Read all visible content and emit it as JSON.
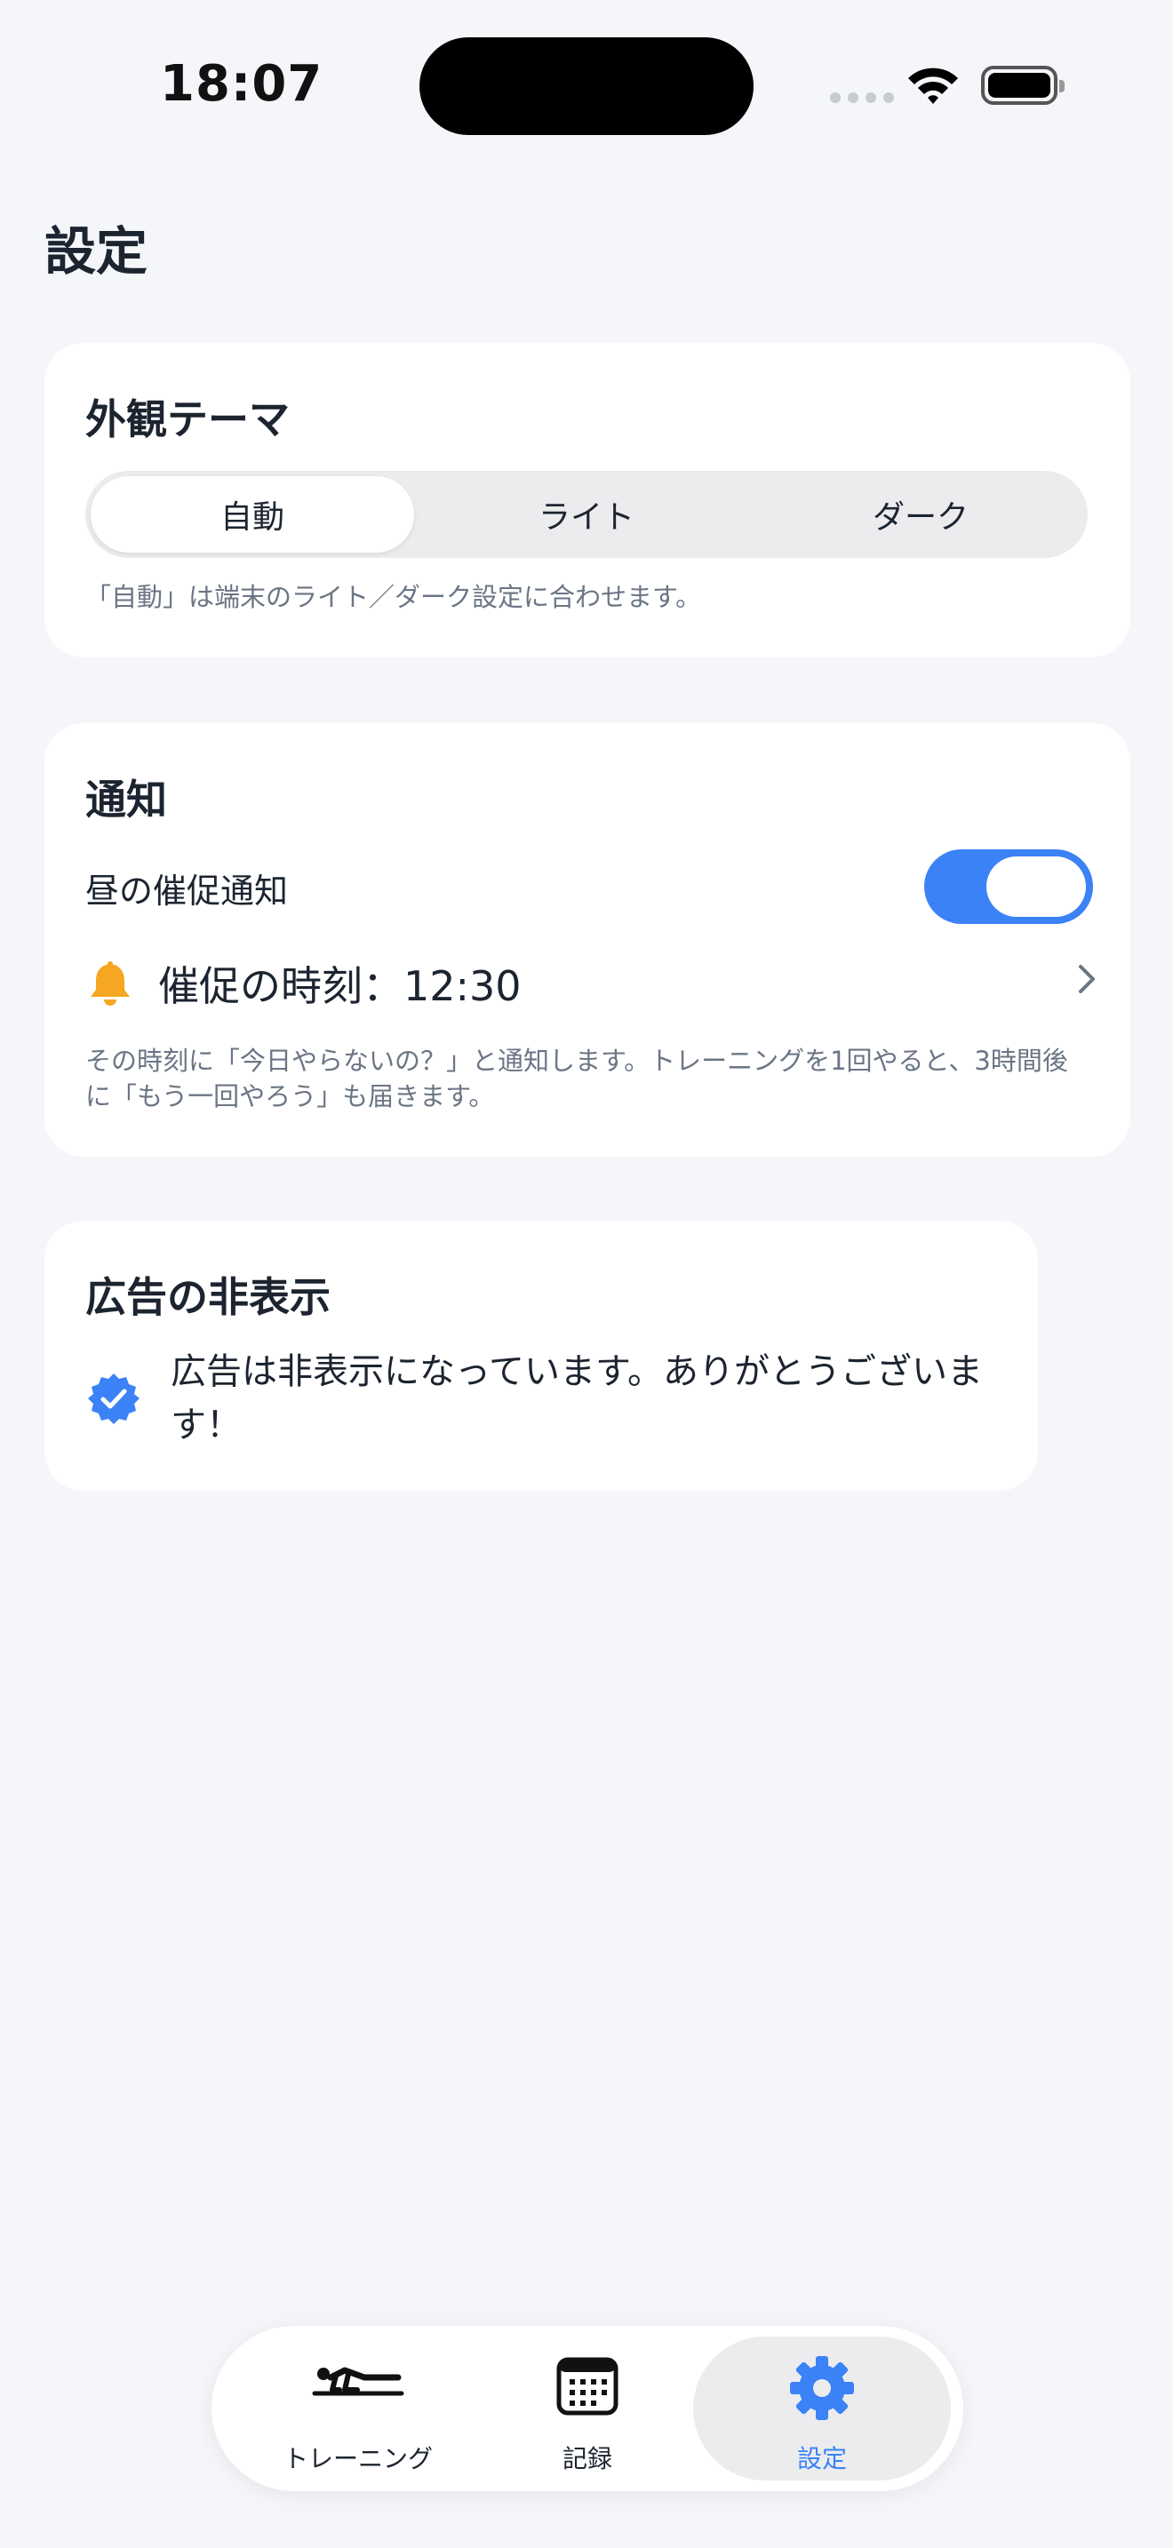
{
  "status_bar": {
    "time": "18:07"
  },
  "page": {
    "title": "設定"
  },
  "theme_card": {
    "title": "外観テーマ",
    "options": [
      "自動",
      "ライト",
      "ダーク"
    ],
    "selected": "自動",
    "note": "「自動」は端末のライト／ダーク設定に合わせます。"
  },
  "notify_card": {
    "title": "通知",
    "toggle_label": "昼の催促通知",
    "toggle_on": true,
    "reminder_label": "催促の時刻：12:30",
    "note": "その時刻に「今日やらないの？」と通知します。トレーニングを1回やると、3時間後に「もう一回やろう」も届きます。"
  },
  "ads_card": {
    "title": "広告の非表示",
    "message": "広告は非表示になっています。ありがとうございます！"
  },
  "tabbar": {
    "tabs": [
      {
        "label": "トレーニング",
        "icon": "pushup-icon"
      },
      {
        "label": "記録",
        "icon": "calendar-icon"
      },
      {
        "label": "設定",
        "icon": "gear-icon"
      }
    ],
    "active": "設定"
  },
  "colors": {
    "accent": "#3b82f6",
    "bell": "#f5a623",
    "background": "#f4f6fa"
  }
}
